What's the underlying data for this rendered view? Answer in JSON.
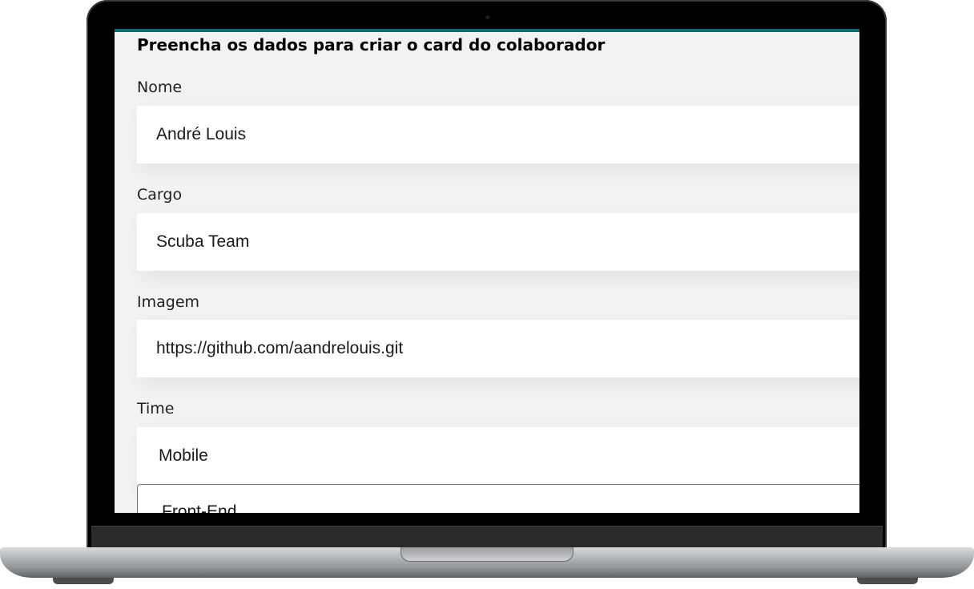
{
  "form": {
    "title": "Preencha os dados para criar o card do colaborador",
    "fields": [
      {
        "label": "Nome",
        "value": "André Louis"
      },
      {
        "label": "Cargo",
        "value": "Scuba Team"
      },
      {
        "label": "Imagem",
        "value": "https://github.com/aandrelouis.git"
      },
      {
        "label": "Time",
        "value": "Mobile"
      }
    ],
    "dropdown": {
      "next_option": "Front-End"
    }
  },
  "colors": {
    "screen_background": "#f2f2f2",
    "accent_bar": "#0b6b73",
    "input_background": "#ffffff"
  }
}
